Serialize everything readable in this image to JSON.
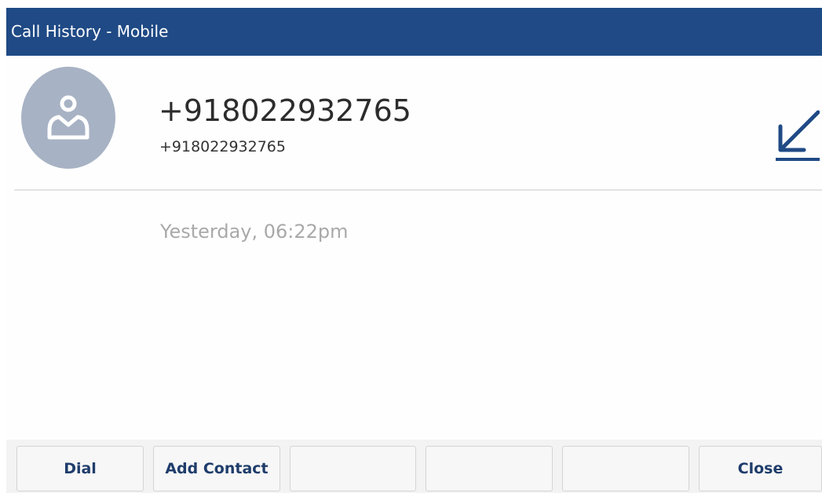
{
  "header": {
    "title": "Call History - Mobile"
  },
  "entry": {
    "avatar_icon": "person-icon",
    "name": "+918022932765",
    "number": "+918022932765",
    "call_type_icon": "incoming-call-arrow-icon",
    "timestamp": "Yesterday, 06:22pm"
  },
  "softkeys": [
    {
      "label": "Dial"
    },
    {
      "label": "Add Contact"
    },
    {
      "label": ""
    },
    {
      "label": ""
    },
    {
      "label": ""
    },
    {
      "label": "Close"
    }
  ],
  "colors": {
    "header_bg": "#1f4a85",
    "accent": "#1f4a85",
    "avatar_bg": "#a7b2c4",
    "softkey_text": "#1f3d6b",
    "timestamp_text": "#a9a9a9"
  }
}
